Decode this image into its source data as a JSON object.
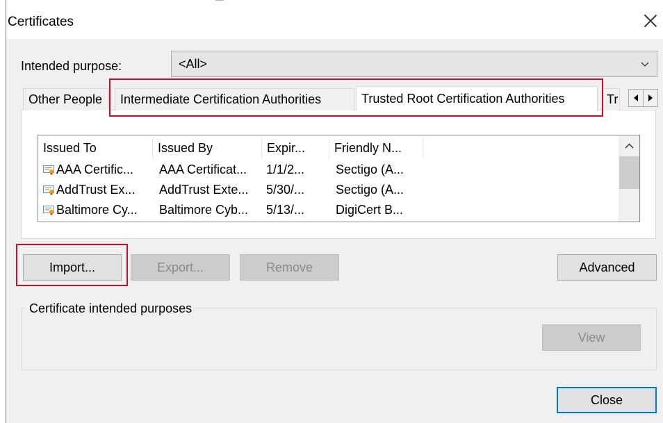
{
  "window": {
    "title": "Certificates"
  },
  "purpose": {
    "label": "Intended purpose:",
    "value": "<All>"
  },
  "tabs": [
    {
      "label": "Other People",
      "active": false
    },
    {
      "label": "Intermediate Certification Authorities",
      "active": false
    },
    {
      "label": "Trusted Root Certification Authorities",
      "active": true
    },
    {
      "label": "Trusted Publishers",
      "visible_text": "Tr",
      "active": false
    }
  ],
  "list": {
    "columns": [
      "Issued To",
      "Issued By",
      "Expir...",
      "Friendly N..."
    ],
    "rows": [
      {
        "issued_to": "AAA Certific...",
        "issued_by": "AAA Certificat...",
        "expiration": "1/1/2...",
        "friendly_name": "Sectigo (A..."
      },
      {
        "issued_to": "AddTrust Ex...",
        "issued_by": "AddTrust Exte...",
        "expiration": "5/30/...",
        "friendly_name": "Sectigo (A..."
      },
      {
        "issued_to": "Baltimore Cy...",
        "issued_by": "Baltimore Cyb...",
        "expiration": "5/13/...",
        "friendly_name": "DigiCert B..."
      }
    ]
  },
  "buttons": {
    "import": "Import...",
    "export": "Export...",
    "remove": "Remove",
    "advanced": "Advanced",
    "view": "View",
    "close": "Close"
  },
  "group": {
    "legend": "Certificate intended purposes"
  },
  "icons": {
    "close": "close-icon",
    "dropdown": "chevron-down-icon",
    "tab_left": "arrow-left-icon",
    "tab_right": "arrow-right-icon",
    "scroll_up": "chevron-up-icon",
    "certificate": "certificate-icon"
  },
  "colors": {
    "highlight": "#c8102e",
    "focus_border": "#0078d7",
    "dialog_bg": "#f0f0f0"
  }
}
